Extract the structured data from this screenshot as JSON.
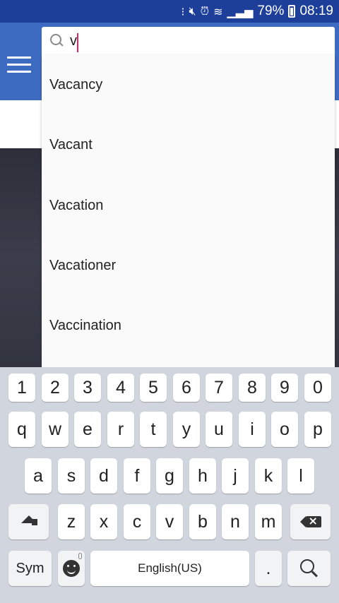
{
  "status_bar": {
    "battery": "79%",
    "time": "08:19",
    "icons": [
      "nfc-icon",
      "mute-icon",
      "alarm-icon",
      "wifi-icon",
      "signal-icon",
      "battery-icon"
    ]
  },
  "search": {
    "value": "v",
    "placeholder": ""
  },
  "suggestions": [
    "Vacancy",
    "Vacant",
    "Vacation",
    "Vacationer",
    "Vaccination"
  ],
  "keyboard": {
    "numbers": [
      "1",
      "2",
      "3",
      "4",
      "5",
      "6",
      "7",
      "8",
      "9",
      "0"
    ],
    "row1": [
      "q",
      "w",
      "e",
      "r",
      "t",
      "y",
      "u",
      "i",
      "o",
      "p"
    ],
    "row2": [
      "a",
      "s",
      "d",
      "f",
      "g",
      "h",
      "j",
      "k",
      "l"
    ],
    "row3": [
      "z",
      "x",
      "c",
      "v",
      "b",
      "n",
      "m"
    ],
    "sym_label": "Sym",
    "space_label": "English(US)",
    "period_label": "."
  },
  "colors": {
    "status_bar": "#1d3f9a",
    "app_bar": "#3e6bc2",
    "keyboard_bg": "#d1d6de",
    "caret": "#e0245e"
  }
}
